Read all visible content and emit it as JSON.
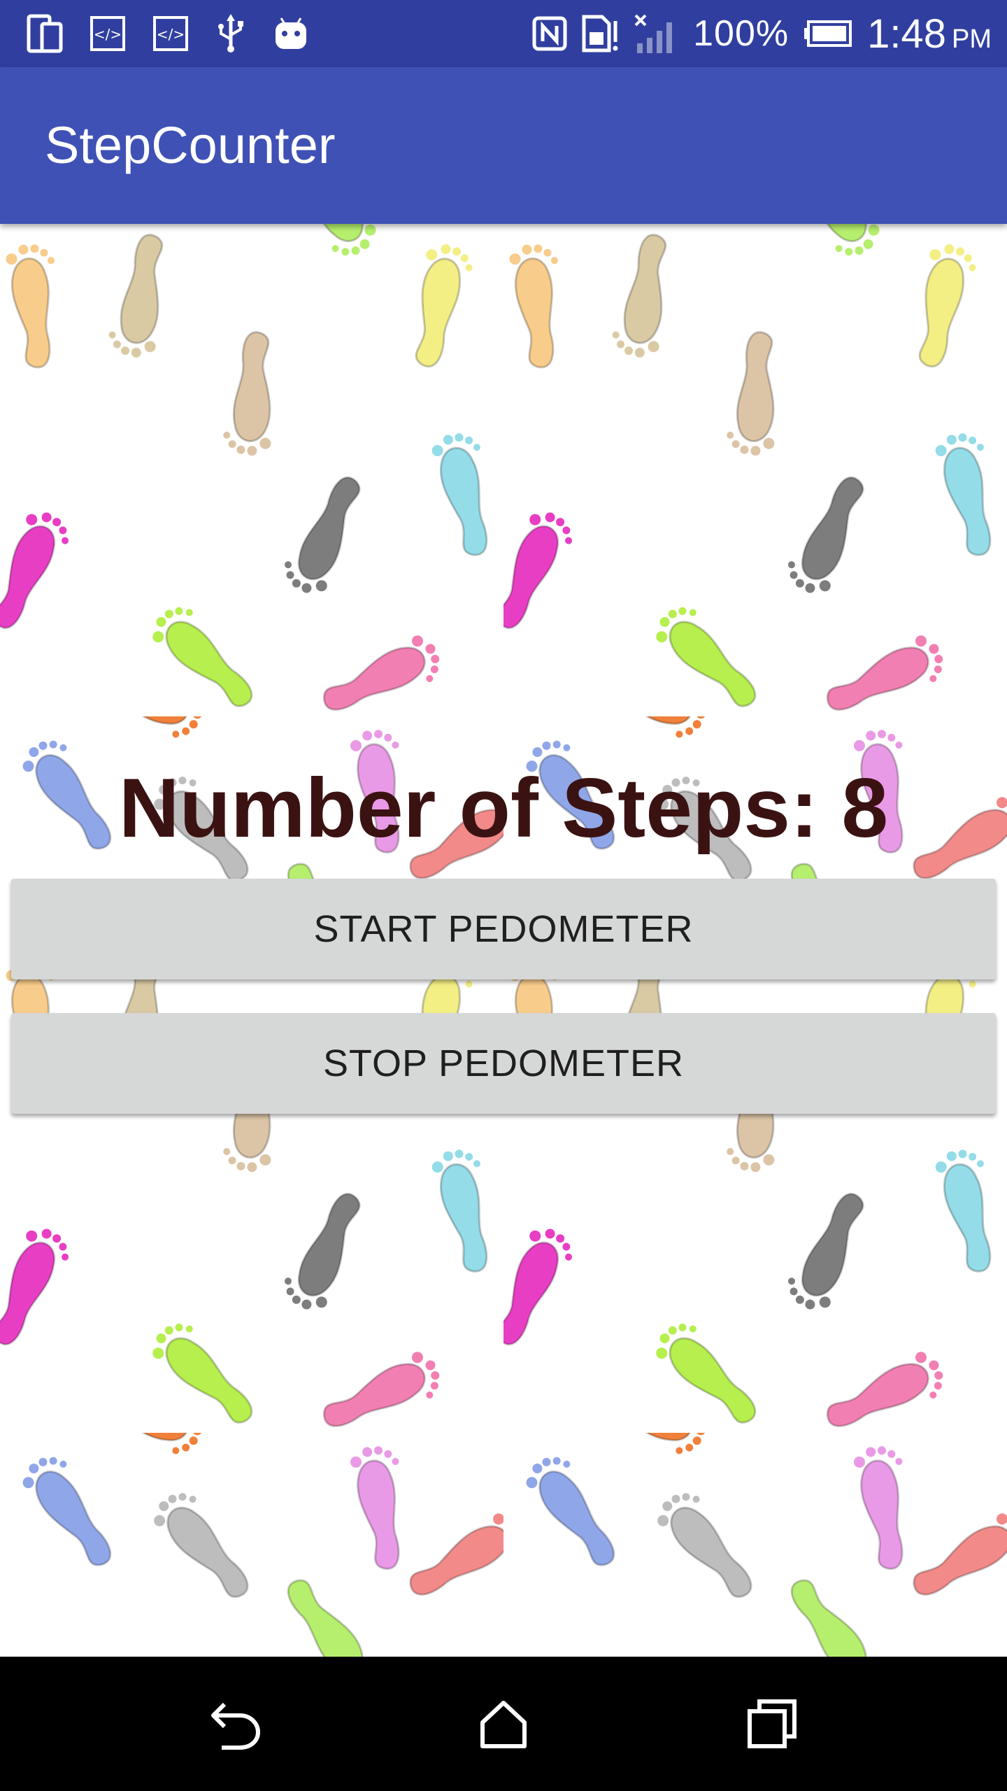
{
  "status_bar": {
    "battery_percent": "100%",
    "time": "1:48",
    "ampm": "PM",
    "icons": [
      "screen-icon",
      "code-icon",
      "code-icon",
      "usb-icon",
      "android-icon",
      "nfc-icon",
      "sim-alert-icon",
      "signal-icon",
      "battery-icon"
    ]
  },
  "app_bar": {
    "title": "StepCounter"
  },
  "main": {
    "steps_label": "Number of Steps: 8",
    "start_button": "START PEDOMETER",
    "stop_button": "STOP PEDOMETER",
    "background": "colorful-footprints-pattern"
  },
  "nav_bar": {
    "icons": [
      "back-icon",
      "home-icon",
      "recents-icon"
    ]
  },
  "colors": {
    "status_bar": "#303f9f",
    "app_bar": "#3f51b5",
    "button": "#d6d7d7",
    "steps_text": "#3b1212"
  }
}
